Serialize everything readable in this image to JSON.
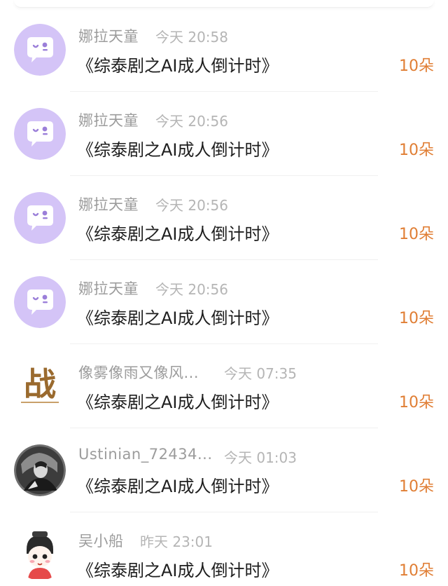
{
  "gifts": [
    {
      "user": "娜拉天童",
      "time": "今天 20:58",
      "title": "《综泰剧之AI成人倒计时》",
      "amount": "10朵",
      "avatar": "chat-bubble-icon"
    },
    {
      "user": "娜拉天童",
      "time": "今天 20:56",
      "title": "《综泰剧之AI成人倒计时》",
      "amount": "10朵",
      "avatar": "chat-bubble-icon"
    },
    {
      "user": "娜拉天童",
      "time": "今天 20:56",
      "title": "《综泰剧之AI成人倒计时》",
      "amount": "10朵",
      "avatar": "chat-bubble-icon"
    },
    {
      "user": "娜拉天童",
      "time": "今天 20:56",
      "title": "《综泰剧之AI成人倒计时》",
      "amount": "10朵",
      "avatar": "chat-bubble-icon"
    },
    {
      "user": "像雾像雨又像风...",
      "time": "今天 07:35",
      "title": "《综泰剧之AI成人倒计时》",
      "amount": "10朵",
      "avatar": "calligraphy-zhan"
    },
    {
      "user": "Ustinian_72434...",
      "time": "今天 01:03",
      "title": "《综泰剧之AI成人倒计时》",
      "amount": "10朵",
      "avatar": "photo-portrait"
    },
    {
      "user": "吴小船",
      "time": "昨天 23:01",
      "title": "《综泰剧之AI成人倒计时》",
      "amount": "10朵",
      "avatar": "cartoon-character"
    }
  ],
  "avatar_art": {
    "calligraphy_char": "战"
  },
  "colors": {
    "amount": "#e07e34",
    "name": "#9c9c9c",
    "time": "#b5b5b5",
    "title": "#1e1e1e",
    "default_avatar_bg": "#d4c4f7"
  }
}
